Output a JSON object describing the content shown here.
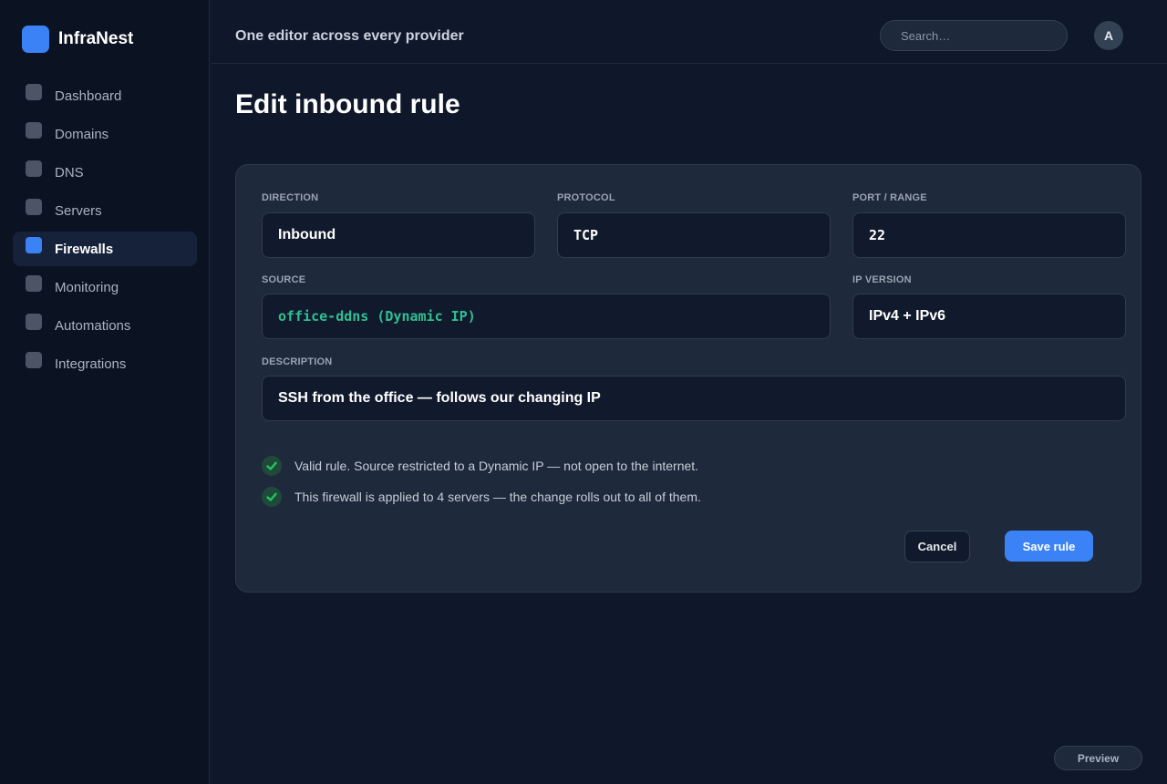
{
  "app": {
    "name": "InfraNest"
  },
  "sidebar": {
    "items": [
      {
        "label": "Dashboard",
        "icon": "dashboard-icon",
        "active": false
      },
      {
        "label": "Domains",
        "icon": "domains-icon",
        "active": false
      },
      {
        "label": "DNS",
        "icon": "dns-icon",
        "active": false
      },
      {
        "label": "Servers",
        "icon": "servers-icon",
        "active": false
      },
      {
        "label": "Firewalls",
        "icon": "firewalls-icon",
        "active": true
      },
      {
        "label": "Monitoring",
        "icon": "monitoring-icon",
        "active": false
      },
      {
        "label": "Automations",
        "icon": "automations-icon",
        "active": false
      },
      {
        "label": "Integrations",
        "icon": "integrations-icon",
        "active": false
      }
    ]
  },
  "header": {
    "tagline": "One editor across every provider",
    "search_placeholder": "Search…",
    "avatar_initial": "A"
  },
  "page": {
    "title": "Edit inbound rule"
  },
  "form": {
    "direction": {
      "label": "DIRECTION",
      "value": "Inbound"
    },
    "protocol": {
      "label": "PROTOCOL",
      "value": "TCP"
    },
    "port": {
      "label": "PORT / RANGE",
      "value": "22"
    },
    "source": {
      "label": "SOURCE",
      "value": "office-ddns (Dynamic IP)"
    },
    "ip_version": {
      "label": "IP VERSION",
      "value": "IPv4 + IPv6"
    },
    "description": {
      "label": "DESCRIPTION",
      "value": "SSH from the office — follows our changing IP"
    }
  },
  "validation": [
    "Valid rule. Source restricted to a Dynamic IP — not open to the internet.",
    "This firewall is applied to 4 servers — the change rolls out to all of them."
  ],
  "actions": {
    "cancel_label": "Cancel",
    "save_label": "Save rule",
    "preview_label": "Preview"
  },
  "colors": {
    "accent": "#3b82f6",
    "success": "#22c55e",
    "source_value": "#2fbf92",
    "background": "#0f172a"
  }
}
